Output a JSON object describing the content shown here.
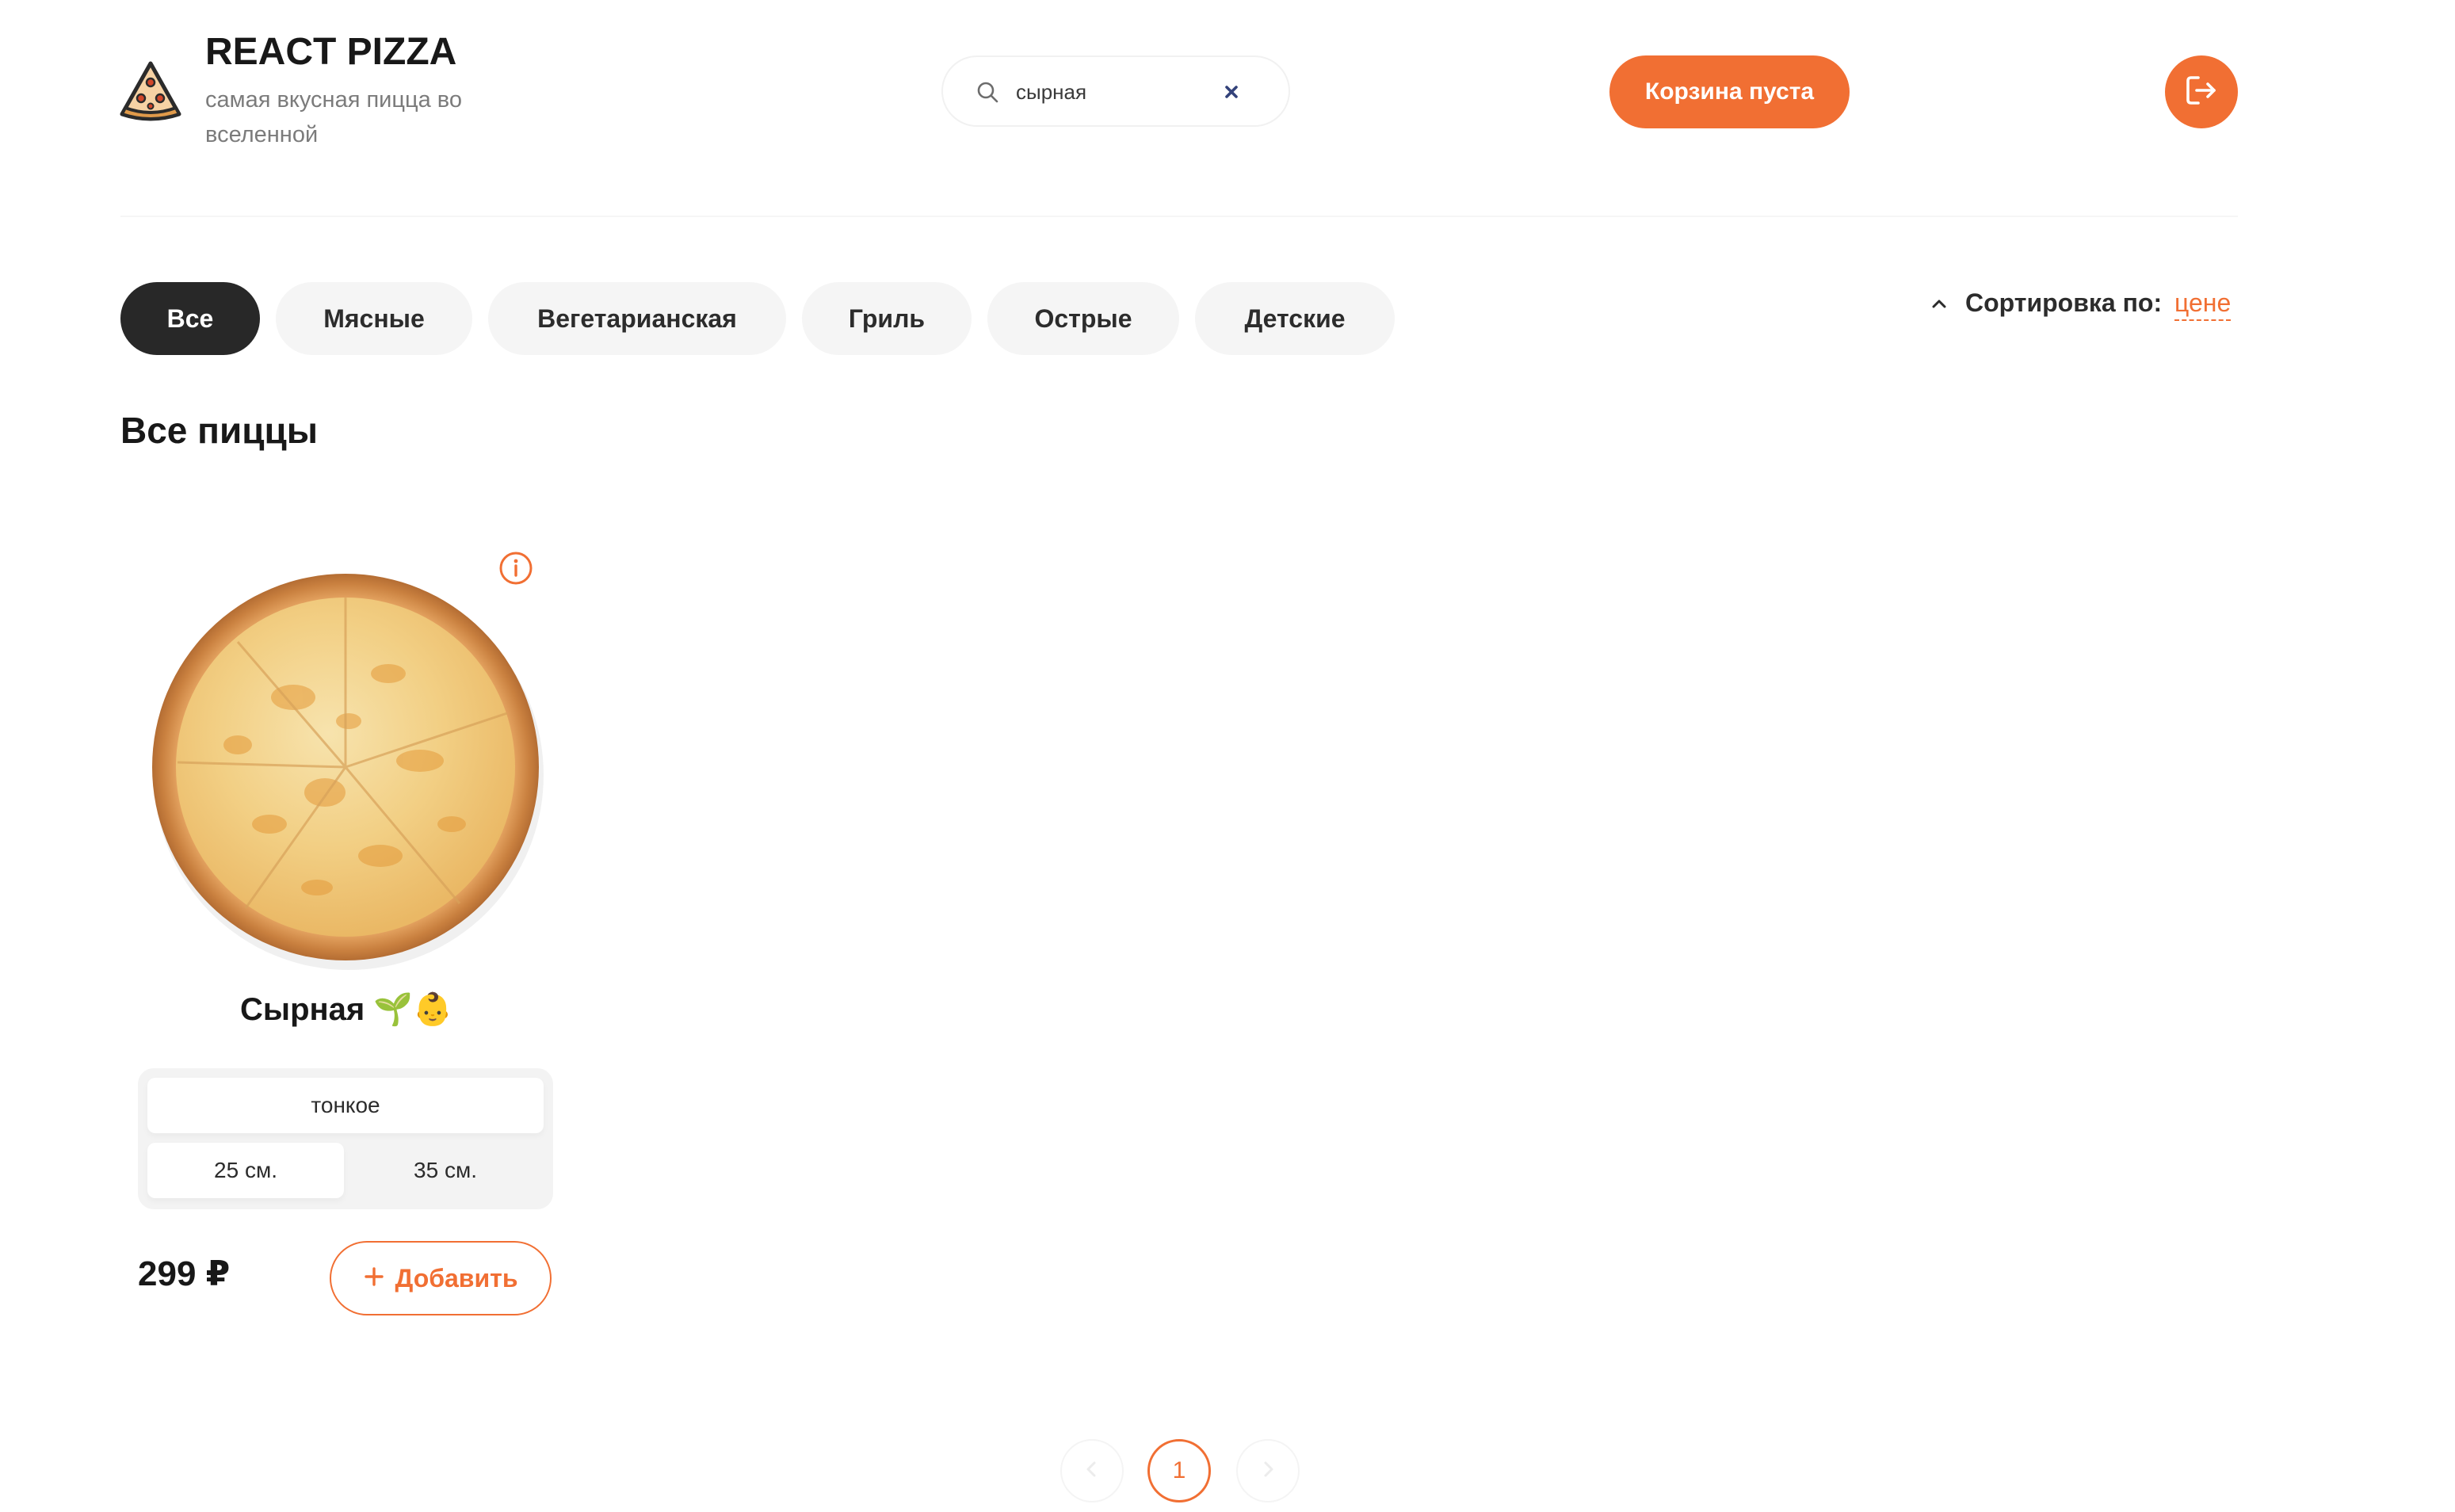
{
  "header": {
    "brand_title": "REACT PIZZA",
    "brand_subtitle": "самая вкусная пицца во вселенной",
    "logo_icon": "pizza-slice-icon",
    "search": {
      "value": "сырная",
      "icon": "search-icon",
      "clear_icon": "close-icon"
    },
    "cart_label": "Корзина пуста",
    "logout_icon": "logout-icon"
  },
  "categories": [
    "Все",
    "Мясные",
    "Вегетарианская",
    "Гриль",
    "Острые",
    "Детские"
  ],
  "active_category": "Все",
  "sort": {
    "label": "Сортировка по:",
    "value": "цене",
    "direction": "asc"
  },
  "section_title": "Все пиццы",
  "pizzas": [
    {
      "title": "Сырная",
      "title_badges": "🌱👶",
      "dough_types": [
        "тонкое"
      ],
      "selected_dough": "тонкое",
      "sizes": [
        "25 см.",
        "35 см."
      ],
      "selected_size": "25 см.",
      "price": "299 ₽",
      "add_label": "Добавить",
      "add_icon": "plus-icon",
      "info_icon": "info-icon"
    }
  ],
  "pagination": {
    "current_page": "1",
    "prev_icon": "chevron-left-icon",
    "next_icon": "chevron-right-icon"
  },
  "colors": {
    "accent": "#f16f33",
    "dark": "#282828",
    "chip": "#f5f5f5",
    "text": "#181818",
    "muted": "#7b7b7b"
  }
}
